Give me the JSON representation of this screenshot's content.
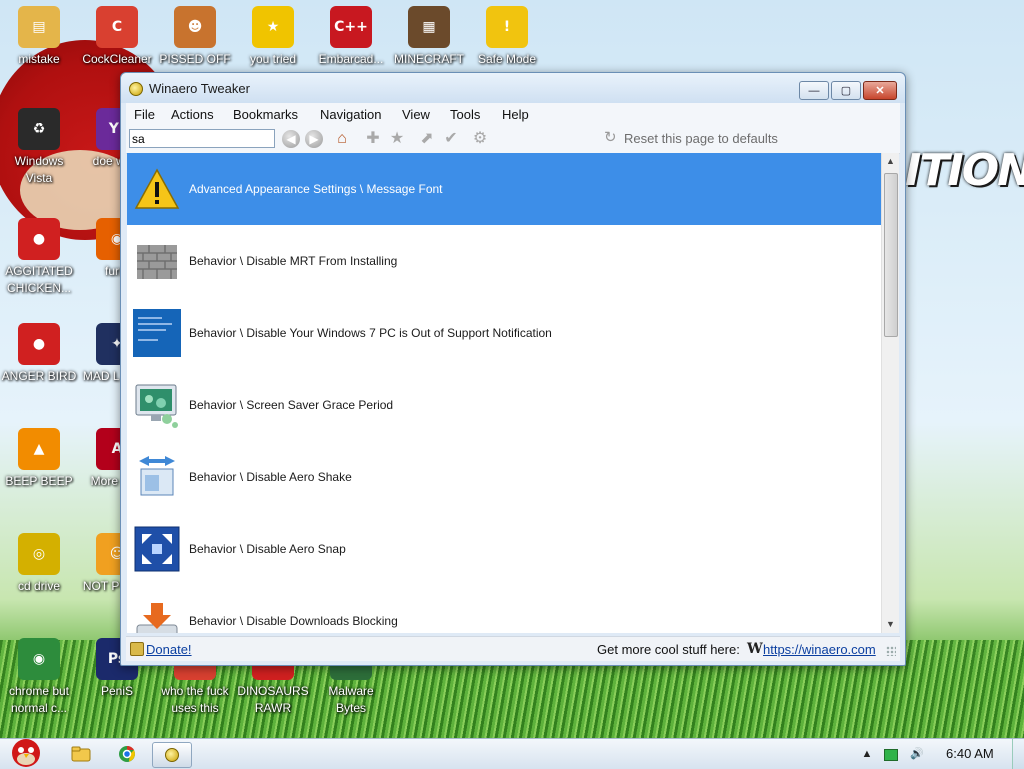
{
  "desktop": {
    "icons": [
      {
        "label": "mistake",
        "icon": "folder-icon",
        "color": "#e4b54a"
      },
      {
        "label": "CockCleaner",
        "icon": "ccleaner-icon",
        "color": "#d94030"
      },
      {
        "label": "PISSED OFF",
        "icon": "angry-birds-seasons-icon",
        "color": "#c8732e"
      },
      {
        "label": "you tried",
        "icon": "star-icon",
        "color": "#f0c400"
      },
      {
        "label": "Embarcad...",
        "icon": "dev-cpp-icon",
        "color": "#c81820"
      },
      {
        "label": "MINECRAFT",
        "icon": "minecraft-icon",
        "color": "#6b4a2b"
      },
      {
        "label": "Safe Mode",
        "icon": "warning-icon",
        "color": "#f1c40f"
      },
      {
        "label": "Windows Vista",
        "icon": "recycle-bin-icon",
        "color": "#2a2a2a"
      },
      {
        "label": "doe work",
        "icon": "yahoo-icon",
        "color": "#6b2a9a"
      },
      {
        "label": "AGGITATED CHICKEN...",
        "icon": "angry-birds-icon",
        "color": "#d02020"
      },
      {
        "label": "furry",
        "icon": "firefox-icon",
        "color": "#e66000"
      },
      {
        "label": "ANGER BIRD",
        "icon": "angry-birds-icon",
        "color": "#d02020"
      },
      {
        "label": "MAD L UNIV",
        "icon": "angry-birds-space-icon",
        "color": "#203060"
      },
      {
        "label": "BEEP BEEP",
        "icon": "vlc-icon",
        "color": "#f28c00"
      },
      {
        "label": "More Rea",
        "icon": "acrobat-reader-icon",
        "color": "#b3001b"
      },
      {
        "label": "cd drive",
        "icon": "cd-drive-icon",
        "color": "#d4b000"
      },
      {
        "label": "NOT P BIRD",
        "icon": "bad-piggies-icon",
        "color": "#f0a020"
      },
      {
        "label": "chrome but normal c...",
        "icon": "chrome-icon",
        "color": "#2d8c3c"
      },
      {
        "label": "PeniS",
        "icon": "photoshop-icon",
        "color": "#1b2a6b"
      },
      {
        "label": "who the fuck uses this",
        "icon": "generic-app-icon",
        "color": "#d94030"
      },
      {
        "label": "DINOSAURS RAWR",
        "icon": "angry-birds-icon",
        "color": "#d02020"
      },
      {
        "label": "Malware Bytes",
        "icon": "malwarebytes-icon",
        "color": "#2d6e3a"
      }
    ],
    "wallpaper_text": "ITION"
  },
  "window": {
    "title": "Winaero Tweaker",
    "controls": {
      "minimize": "—",
      "maximize": "▢",
      "close": "✕"
    },
    "menu": [
      "File",
      "Actions",
      "Bookmarks",
      "Navigation",
      "View",
      "Tools",
      "Help"
    ],
    "search": {
      "value": "sa",
      "placeholder": ""
    },
    "toolbar": {
      "reset_label": "Reset this page to defaults"
    },
    "results": [
      {
        "label": "Advanced Appearance Settings \\ Message Font",
        "icon": "warning-icon",
        "selected": true
      },
      {
        "label": "Behavior \\ Disable MRT From Installing",
        "icon": "brick-wall-icon",
        "selected": false
      },
      {
        "label": "Behavior \\ Disable Your Windows 7 PC is Out of Support Notification",
        "icon": "blue-screen-icon",
        "selected": false
      },
      {
        "label": "Behavior \\ Screen Saver Grace Period",
        "icon": "monitor-screensaver-icon",
        "selected": false
      },
      {
        "label": "Behavior \\ Disable Aero Shake",
        "icon": "aero-shake-icon",
        "selected": false
      },
      {
        "label": "Behavior \\ Disable Aero Snap",
        "icon": "aero-snap-icon",
        "selected": false
      },
      {
        "label": "Behavior \\ Disable Downloads Blocking",
        "icon": "download-icon",
        "selected": false
      }
    ],
    "status": {
      "donate": "Donate!",
      "get_more": "Get more cool stuff here:",
      "logo": "W",
      "url": "https://winaero.com"
    }
  },
  "taskbar": {
    "time": "6:40 AM",
    "items": [
      "start-orb",
      "explorer",
      "chrome",
      "winaero-tweaker"
    ]
  },
  "colors": {
    "selection": "#3d8ee8",
    "link": "#0b3fa0",
    "close_button": "#c7452c"
  }
}
